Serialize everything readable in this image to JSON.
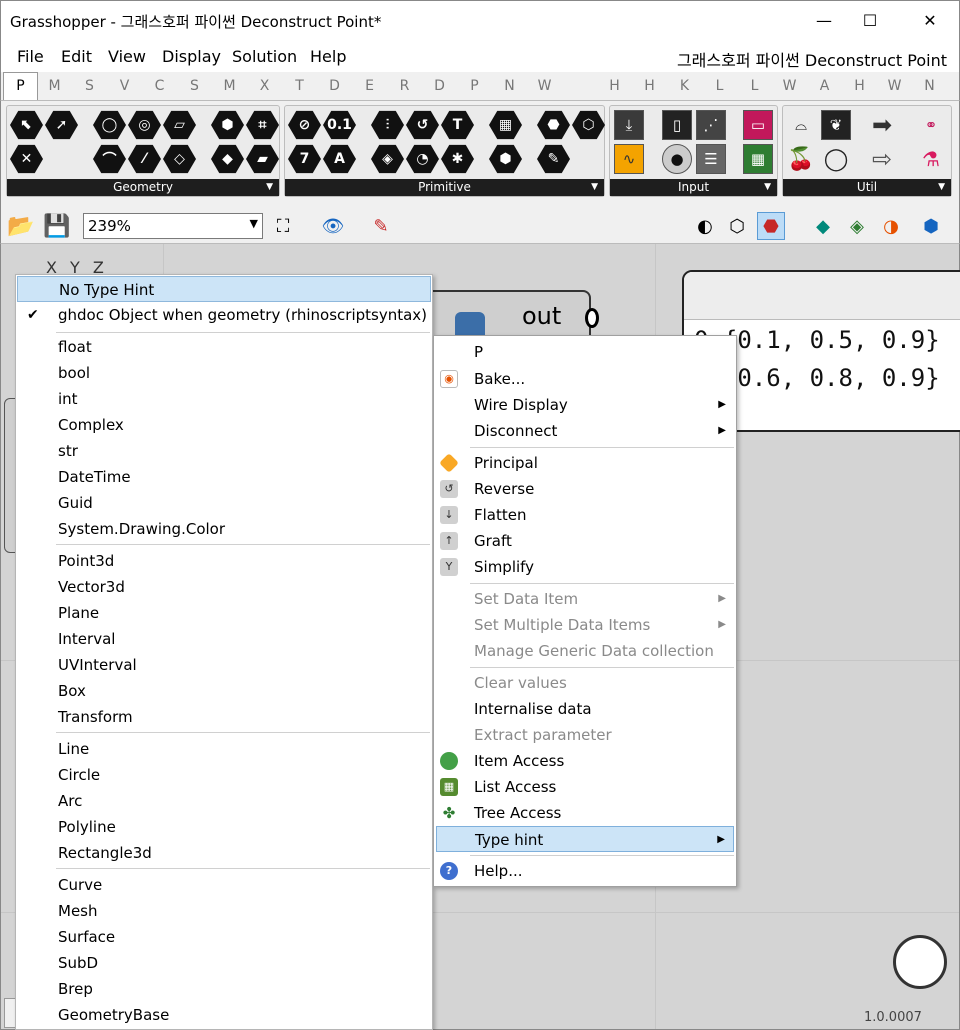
{
  "window": {
    "title": "Grasshopper - 그래스호퍼 파이썬 Deconstruct Point*",
    "minimize": "—",
    "maximize": "☐",
    "close": "✕"
  },
  "menubar": {
    "items": [
      "File",
      "Edit",
      "View",
      "Display",
      "Solution",
      "Help"
    ],
    "doc_title": "그래스호퍼 파이썬 Deconstruct Point"
  },
  "tabs": [
    "P",
    "M",
    "S",
    "V",
    "C",
    "S",
    "M",
    "X",
    "T",
    "D",
    "E",
    "R",
    "D",
    "P",
    "N",
    "W",
    "H",
    "H",
    "K",
    "L",
    "L",
    "W",
    "A",
    "H",
    "W",
    "N"
  ],
  "ribbon": {
    "panels": [
      "Geometry",
      "Primitive",
      "Input",
      "Util"
    ]
  },
  "toolbar": {
    "zoom": "239%"
  },
  "canvas": {
    "component_output": "out",
    "panel_lines": [
      "0 {0.1, 0.5, 0.9}",
      "1 {0.6, 0.8, 0.9}"
    ],
    "node_label": "X Y Z"
  },
  "type_hint_menu": {
    "items": [
      {
        "label": "No Type Hint",
        "selected": true
      },
      {
        "label": "ghdoc Object when geometry (rhinoscriptsyntax)",
        "checked": true
      },
      {
        "label": "float"
      },
      {
        "label": "bool"
      },
      {
        "label": "int"
      },
      {
        "label": "Complex"
      },
      {
        "label": "str"
      },
      {
        "label": "DateTime"
      },
      {
        "label": "Guid"
      },
      {
        "label": "System.Drawing.Color"
      },
      {
        "label": "Point3d"
      },
      {
        "label": "Vector3d"
      },
      {
        "label": "Plane"
      },
      {
        "label": "Interval"
      },
      {
        "label": "UVInterval"
      },
      {
        "label": "Box"
      },
      {
        "label": "Transform"
      },
      {
        "label": "Line"
      },
      {
        "label": "Circle"
      },
      {
        "label": "Arc"
      },
      {
        "label": "Polyline"
      },
      {
        "label": "Rectangle3d"
      },
      {
        "label": "Curve"
      },
      {
        "label": "Mesh"
      },
      {
        "label": "Surface"
      },
      {
        "label": "SubD"
      },
      {
        "label": "Brep"
      },
      {
        "label": "GeometryBase"
      }
    ],
    "check_glyph": "✔"
  },
  "context_menu": {
    "items": [
      {
        "label": "P"
      },
      {
        "label": "Bake..."
      },
      {
        "label": "Wire Display",
        "submenu": "▶"
      },
      {
        "label": "Disconnect",
        "submenu": "▶"
      },
      {
        "label": "Principal"
      },
      {
        "label": "Reverse"
      },
      {
        "label": "Flatten"
      },
      {
        "label": "Graft"
      },
      {
        "label": "Simplify"
      },
      {
        "label": "Set Data Item",
        "submenu": "▶",
        "disabled": true
      },
      {
        "label": "Set Multiple Data Items",
        "submenu": "▶",
        "disabled": true
      },
      {
        "label": "Manage Generic Data collection",
        "disabled": true
      },
      {
        "label": "Clear values",
        "disabled": true
      },
      {
        "label": "Internalise data"
      },
      {
        "label": "Extract parameter",
        "disabled": true
      },
      {
        "label": "Item Access"
      },
      {
        "label": "List Access"
      },
      {
        "label": "Tree Access"
      },
      {
        "label": "Type hint",
        "submenu": "▶",
        "selected": true
      },
      {
        "label": "Help..."
      }
    ]
  },
  "status": {
    "version": "1.0.0007"
  },
  "colors": {
    "selection": "#cce4f7",
    "canvas": "#d4d4d4",
    "disabled_text": "#8a8a8a"
  }
}
